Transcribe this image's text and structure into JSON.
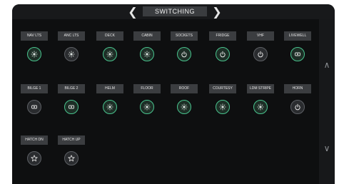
{
  "header": {
    "title": "SWITCHING",
    "prev_icon": "chevron-left-icon",
    "next_icon": "chevron-right-icon"
  },
  "colors": {
    "on_ring": "#49c48e",
    "off_ring": "#5d6065",
    "label_bg": "#3b3d40",
    "screen_bg": "#0e0f10"
  },
  "tiles": [
    {
      "label": "NAV LTS",
      "icon": "light-icon",
      "state": "on"
    },
    {
      "label": "ANC LTS",
      "icon": "light-icon",
      "state": "off"
    },
    {
      "label": "DECK",
      "icon": "light-icon",
      "state": "on"
    },
    {
      "label": "CABIN",
      "icon": "light-icon",
      "state": "on"
    },
    {
      "label": "SOCKETS",
      "icon": "power-icon",
      "state": "on"
    },
    {
      "label": "FRIDGE",
      "icon": "power-icon",
      "state": "on"
    },
    {
      "label": "VHF",
      "icon": "power-icon",
      "state": "off"
    },
    {
      "label": "LIVEWELL",
      "icon": "pump-icon",
      "state": "on"
    },
    {
      "label": "BILGE 1",
      "icon": "pump-icon",
      "state": "off"
    },
    {
      "label": "BILGE 2",
      "icon": "pump-icon",
      "state": "on"
    },
    {
      "label": "HELM",
      "icon": "light-icon",
      "state": "on"
    },
    {
      "label": "FLOOR",
      "icon": "light-icon",
      "state": "on"
    },
    {
      "label": "ROOF",
      "icon": "light-icon",
      "state": "on"
    },
    {
      "label": "COURTESY",
      "icon": "light-icon",
      "state": "on"
    },
    {
      "label": "LDM STRIPE",
      "icon": "light-icon",
      "state": "on"
    },
    {
      "label": "HORN",
      "icon": "power-icon",
      "state": "off"
    },
    {
      "label": "HATCH DN",
      "icon": "star-icon",
      "state": "off"
    },
    {
      "label": "HATCH UP",
      "icon": "star-icon",
      "state": "off"
    }
  ],
  "scroll": {
    "up_icon": "chevron-up-icon",
    "down_icon": "chevron-down-icon"
  }
}
